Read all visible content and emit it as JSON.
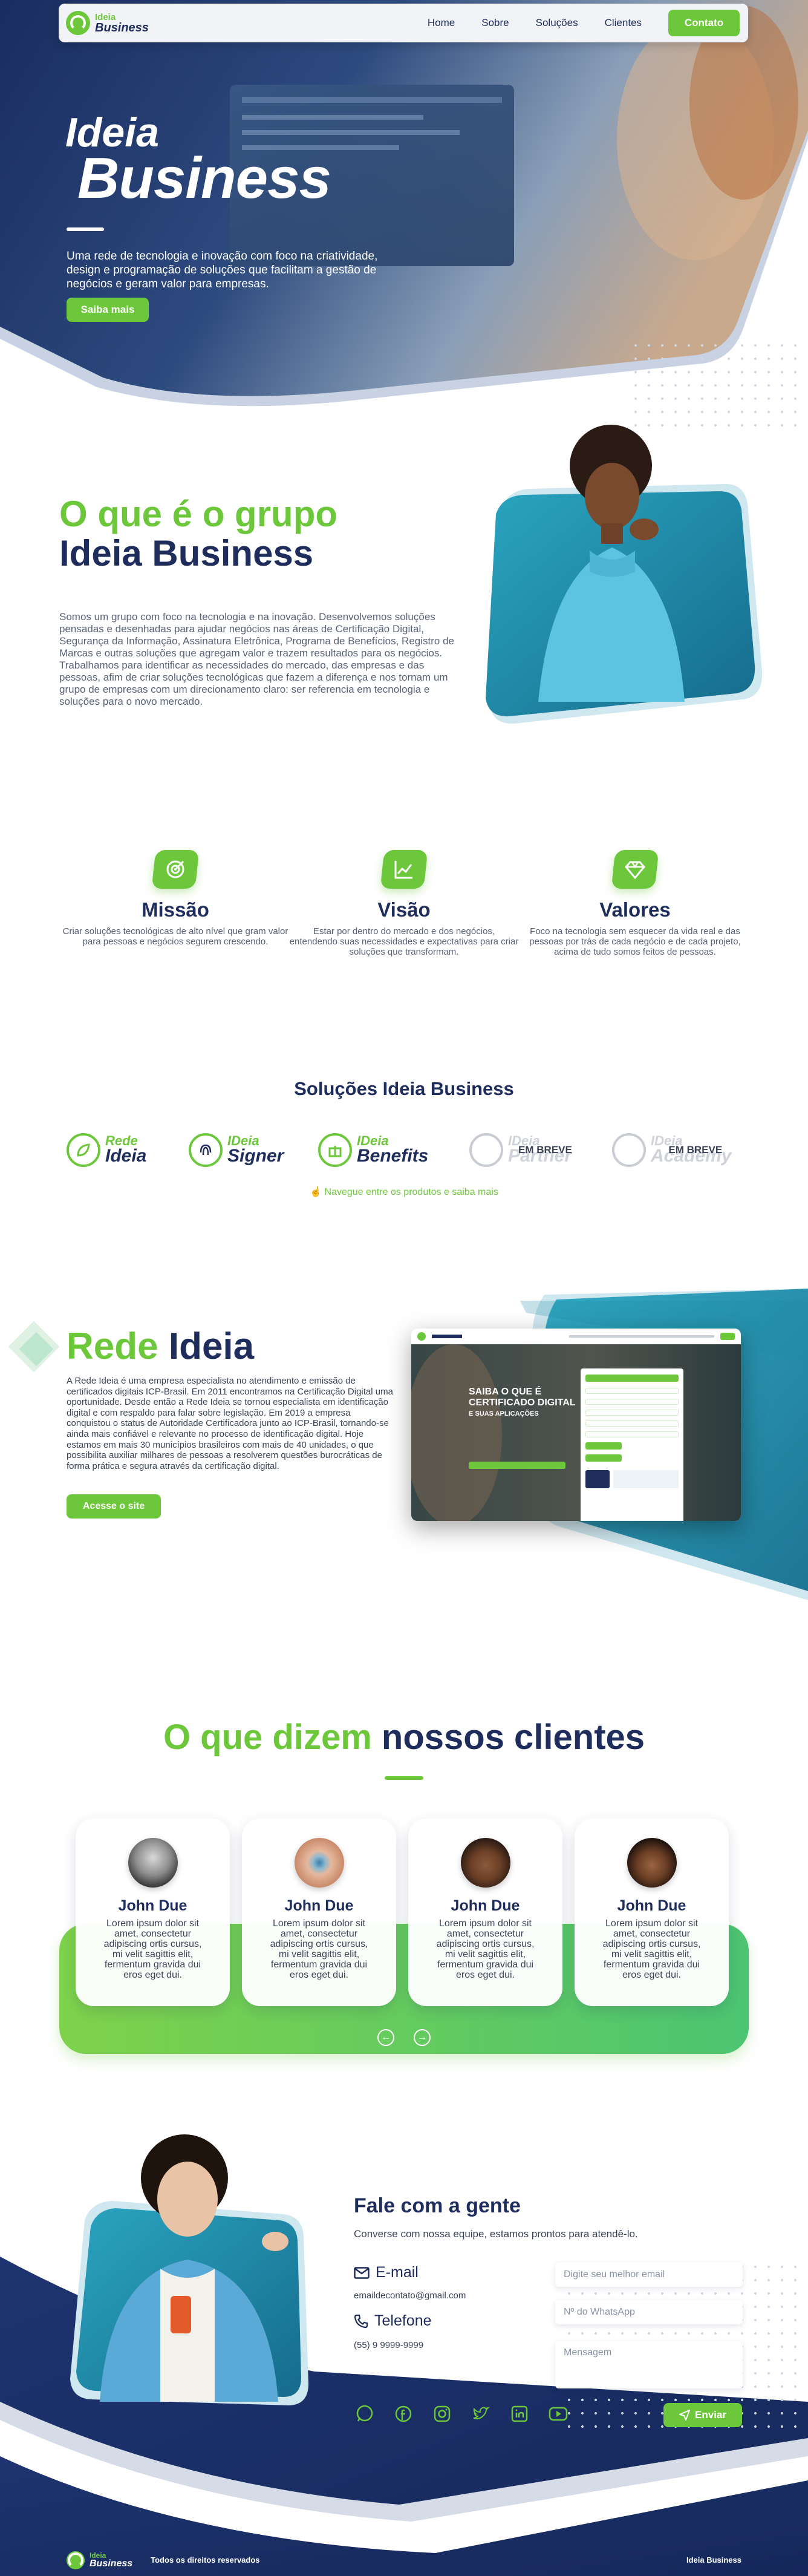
{
  "nav": {
    "logo_top": "Ideia",
    "logo_bottom": "Business",
    "links": [
      "Home",
      "Sobre",
      "Soluções",
      "Clientes"
    ],
    "cta": "Contato"
  },
  "hero": {
    "title_line1": "Ideia",
    "title_line2": "Business",
    "description": "Uma rede de tecnologia e inovação com foco na criatividade, design e programação de soluções que facilitam a gestão de negócios e geram valor para empresas.",
    "button": "Saiba mais"
  },
  "about": {
    "title_line1": "O que é o grupo",
    "title_line2": "Ideia Business",
    "text": "Somos um grupo com foco na tecnologia e na inovação. Desenvolvemos soluções pensadas e desenhadas para ajudar negócios nas áreas de Certificação Digital, Segurança da Informação, Assinatura Eletrônica, Programa de Benefícios, Registro de Marcas e outras soluções que agregam valor e trazem resultados para os negócios. Trabalhamos para identificar as necessidades do mercado, das empresas e das pessoas, afim de criar soluções tecnológicas que fazem a diferença e nos tornam um grupo de empresas com um direcionamento claro: ser referencia em tecnologia e soluções para o novo mercado."
  },
  "mvv": [
    {
      "icon": "target-icon",
      "title": "Missão",
      "text": "Criar soluções tecnológicas de alto nível que gram valor para pessoas e negócios segurem crescendo."
    },
    {
      "icon": "chart-icon",
      "title": "Visão",
      "text": "Estar por dentro do mercado e dos negócios, entendendo suas necessidades e expectativas para criar soluções que transformam."
    },
    {
      "icon": "diamond-icon",
      "title": "Valores",
      "text": "Foco na tecnologia sem esquecer da vida real e das pessoas por trás de cada negócio e de cada projeto, acima de tudo somos feitos de pessoas."
    }
  ],
  "solutions": {
    "title": "Soluções Ideia Business",
    "logos": [
      {
        "top": "Rede",
        "bottom": "Ideia",
        "status": ""
      },
      {
        "top": "IDeia",
        "bottom": "Signer",
        "status": ""
      },
      {
        "top": "IDeia",
        "bottom": "Benefits",
        "status": ""
      },
      {
        "top": "IDeia",
        "bottom": "Partner",
        "status": "EM BREVE"
      },
      {
        "top": "IDeia",
        "bottom": "Academy",
        "status": "EM BREVE"
      }
    ],
    "hint": "Navegue entre os produtos e saiba mais"
  },
  "rede": {
    "title_a": "Rede",
    "title_b": "Ideia",
    "text": "A Rede Ideia é uma empresa especialista no atendimento e emissão de certificados digitais ICP-Brasil. Em 2011 encontramos na Certificação Digital uma oportunidade. Desde então a Rede Ideia se tornou especialista em identificação digital e com respaldo para falar sobre legislação. Em 2019 a empresa conquistou o status de Autoridade Certificadora junto ao ICP-Brasil, tornando-se ainda mais confiável e relevante no processo de identificação digital. Hoje estamos em mais 30 municípios brasileiros com mais de 40 unidades, o que possibilita auxiliar milhares de pessoas a resolverem questões burocráticas de forma prática e segura através da certificação digital.",
    "button": "Acesse o site",
    "mock_heading_1": "SAIBA O QUE É",
    "mock_heading_2": "CERTIFICADO DIGITAL",
    "mock_heading_3": "E SUAS APLICAÇÕES"
  },
  "testimonials": {
    "title_a": "O que dizem",
    "title_b": "nossos clientes",
    "items": [
      {
        "name": "John Due",
        "text": "Lorem ipsum dolor sit amet, consectetur adipiscing ortis cursus, mi velit sagittis elit, fermentum gravida dui eros eget dui."
      },
      {
        "name": "John Due",
        "text": "Lorem ipsum dolor sit amet, consectetur adipiscing ortis cursus, mi velit sagittis elit, fermentum gravida dui eros eget dui."
      },
      {
        "name": "John Due",
        "text": "Lorem ipsum dolor sit amet, consectetur adipiscing ortis cursus, mi velit sagittis elit, fermentum gravida dui eros eget dui."
      },
      {
        "name": "John Due",
        "text": "Lorem ipsum dolor sit amet, consectetur adipiscing ortis cursus, mi velit sagittis elit, fermentum gravida dui eros eget dui."
      }
    ]
  },
  "contact": {
    "title": "Fale com a gente",
    "subtitle": "Converse com nossa equipe, estamos prontos para atendê-lo.",
    "email_label": "E-mail",
    "email_value": "emaildecontato@gmail.com",
    "phone_label": "Telefone",
    "phone_value": "(55) 9 9999-9999",
    "email_placeholder": "Digite seu melhor email",
    "whatsapp_placeholder": "Nº do WhatsApp",
    "message_placeholder": "Mensagem",
    "send": "Enviar"
  },
  "footer": {
    "copyright": "Todos os direitos reservados",
    "brand": "Ideia Business"
  },
  "colors": {
    "navy": "#1e2d5c",
    "green": "#6cc73a",
    "teal": "#1d8aa5"
  }
}
